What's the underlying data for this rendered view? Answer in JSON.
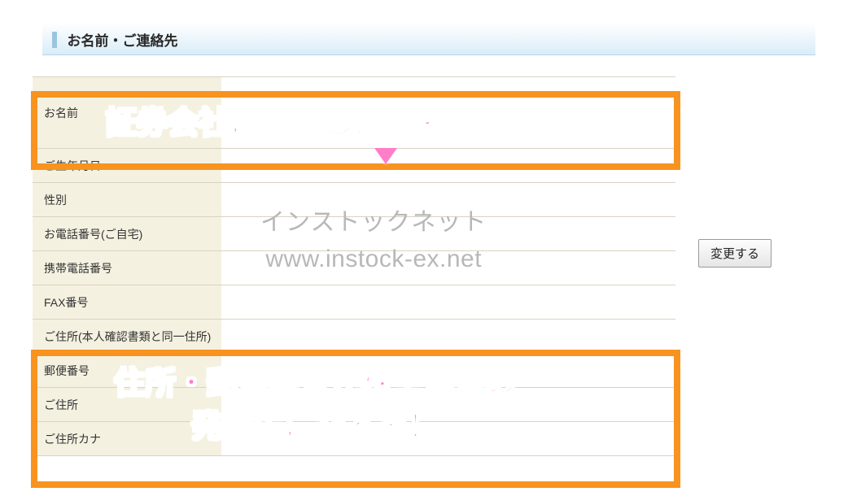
{
  "section": {
    "title": "お名前・ご連絡先"
  },
  "rows": {
    "name": "お名前",
    "birthdate": "ご生年月日",
    "gender": "性別",
    "phone_home": "お電話番号(ご自宅)",
    "phone_mobile": "携帯電話番号",
    "fax": "FAX番号",
    "addr_head": "ご住所(本人確認書類と同一住所)",
    "postal": "郵便番号",
    "address": "ご住所",
    "address_kana": "ご住所カナ"
  },
  "button": {
    "change": "変更する"
  },
  "watermark": {
    "line1": "インストックネット",
    "line2": "www.instock-ex.net"
  },
  "annotations": {
    "a1": "証券会社に登録したお名前と",
    "a2_line1": "住所・郵便番号が株主優待の",
    "a2_line2": "発送先になるぞ！"
  }
}
